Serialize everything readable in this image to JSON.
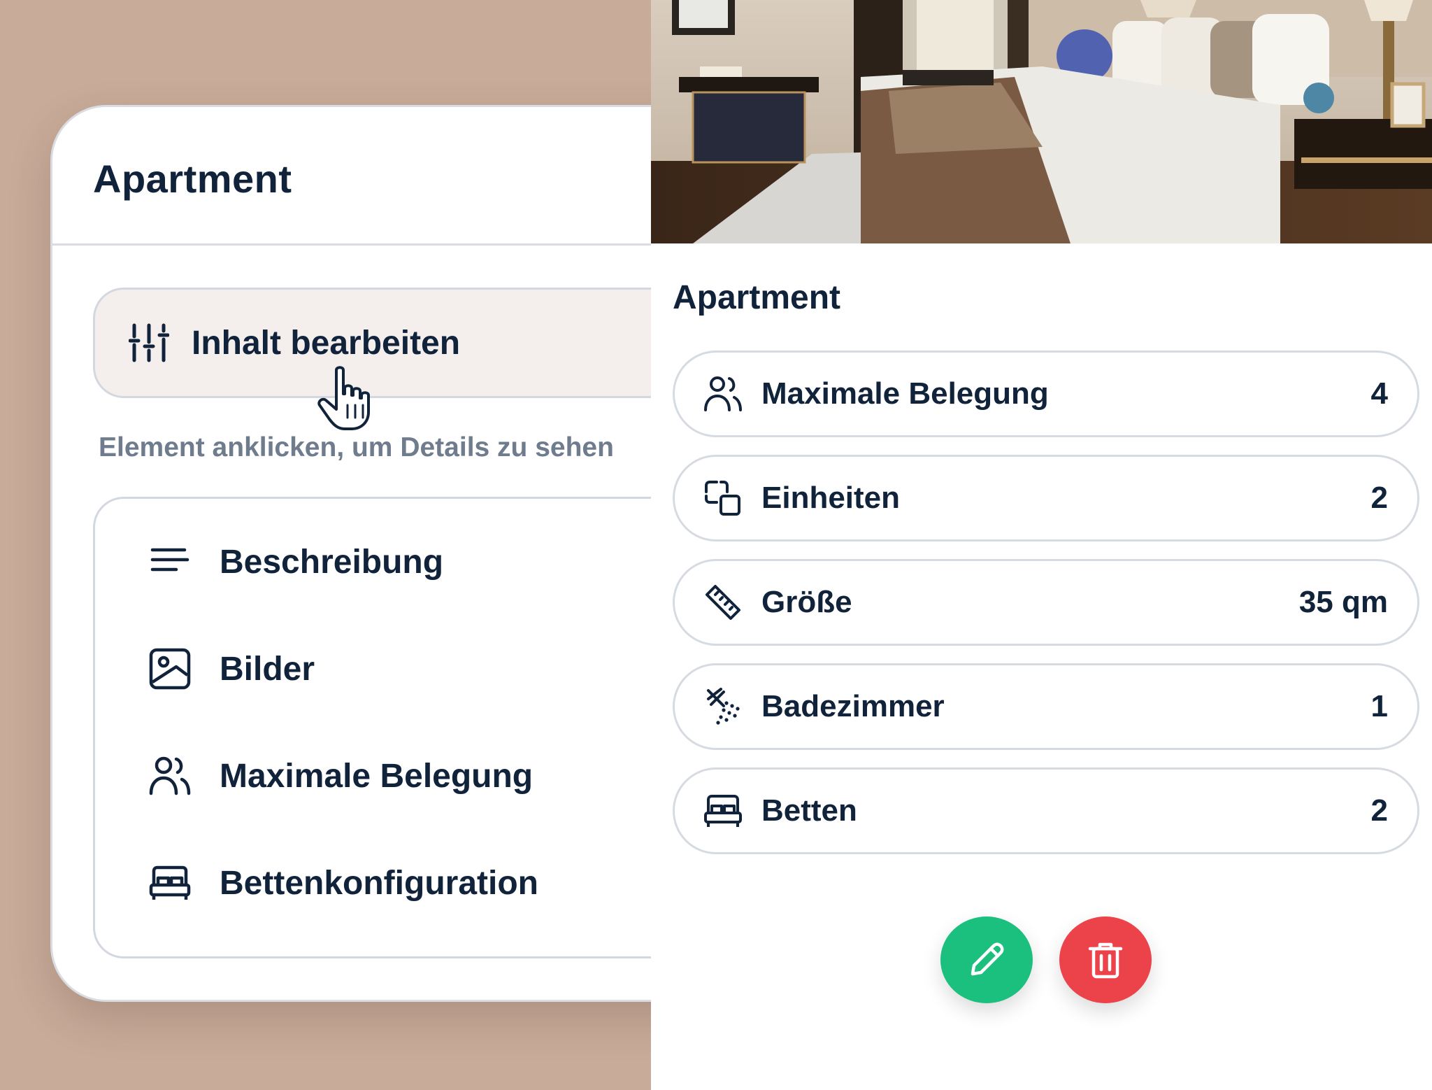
{
  "left_card": {
    "title": "Apartment",
    "edit_button_label": "Inhalt bearbeiten",
    "hint": "Element anklicken, um Details zu sehen",
    "menu": [
      {
        "label": "Beschreibung",
        "icon": "text-lines-icon"
      },
      {
        "label": "Bilder",
        "icon": "image-icon"
      },
      {
        "label": "Maximale Belegung",
        "icon": "users-icon"
      },
      {
        "label": "Bettenkonfiguration",
        "icon": "bed-icon"
      }
    ]
  },
  "right_panel": {
    "photo": "bedroom-photo",
    "title": "Apartment",
    "rows": [
      {
        "label": "Maximale Belegung",
        "value": "4",
        "icon": "users-icon"
      },
      {
        "label": "Einheiten",
        "value": "2",
        "icon": "units-icon"
      },
      {
        "label": "Größe",
        "value": "35 qm",
        "icon": "ruler-icon"
      },
      {
        "label": "Badezimmer",
        "value": "1",
        "icon": "shower-icon"
      },
      {
        "label": "Betten",
        "value": "2",
        "icon": "bed-icon"
      }
    ],
    "actions": {
      "edit_icon": "pencil-icon",
      "delete_icon": "trash-icon"
    }
  },
  "colors": {
    "background": "#c8ab99",
    "text": "#10233a",
    "hint": "#6f7c8d",
    "edit": "#1bbf7e",
    "delete": "#ec4249"
  }
}
